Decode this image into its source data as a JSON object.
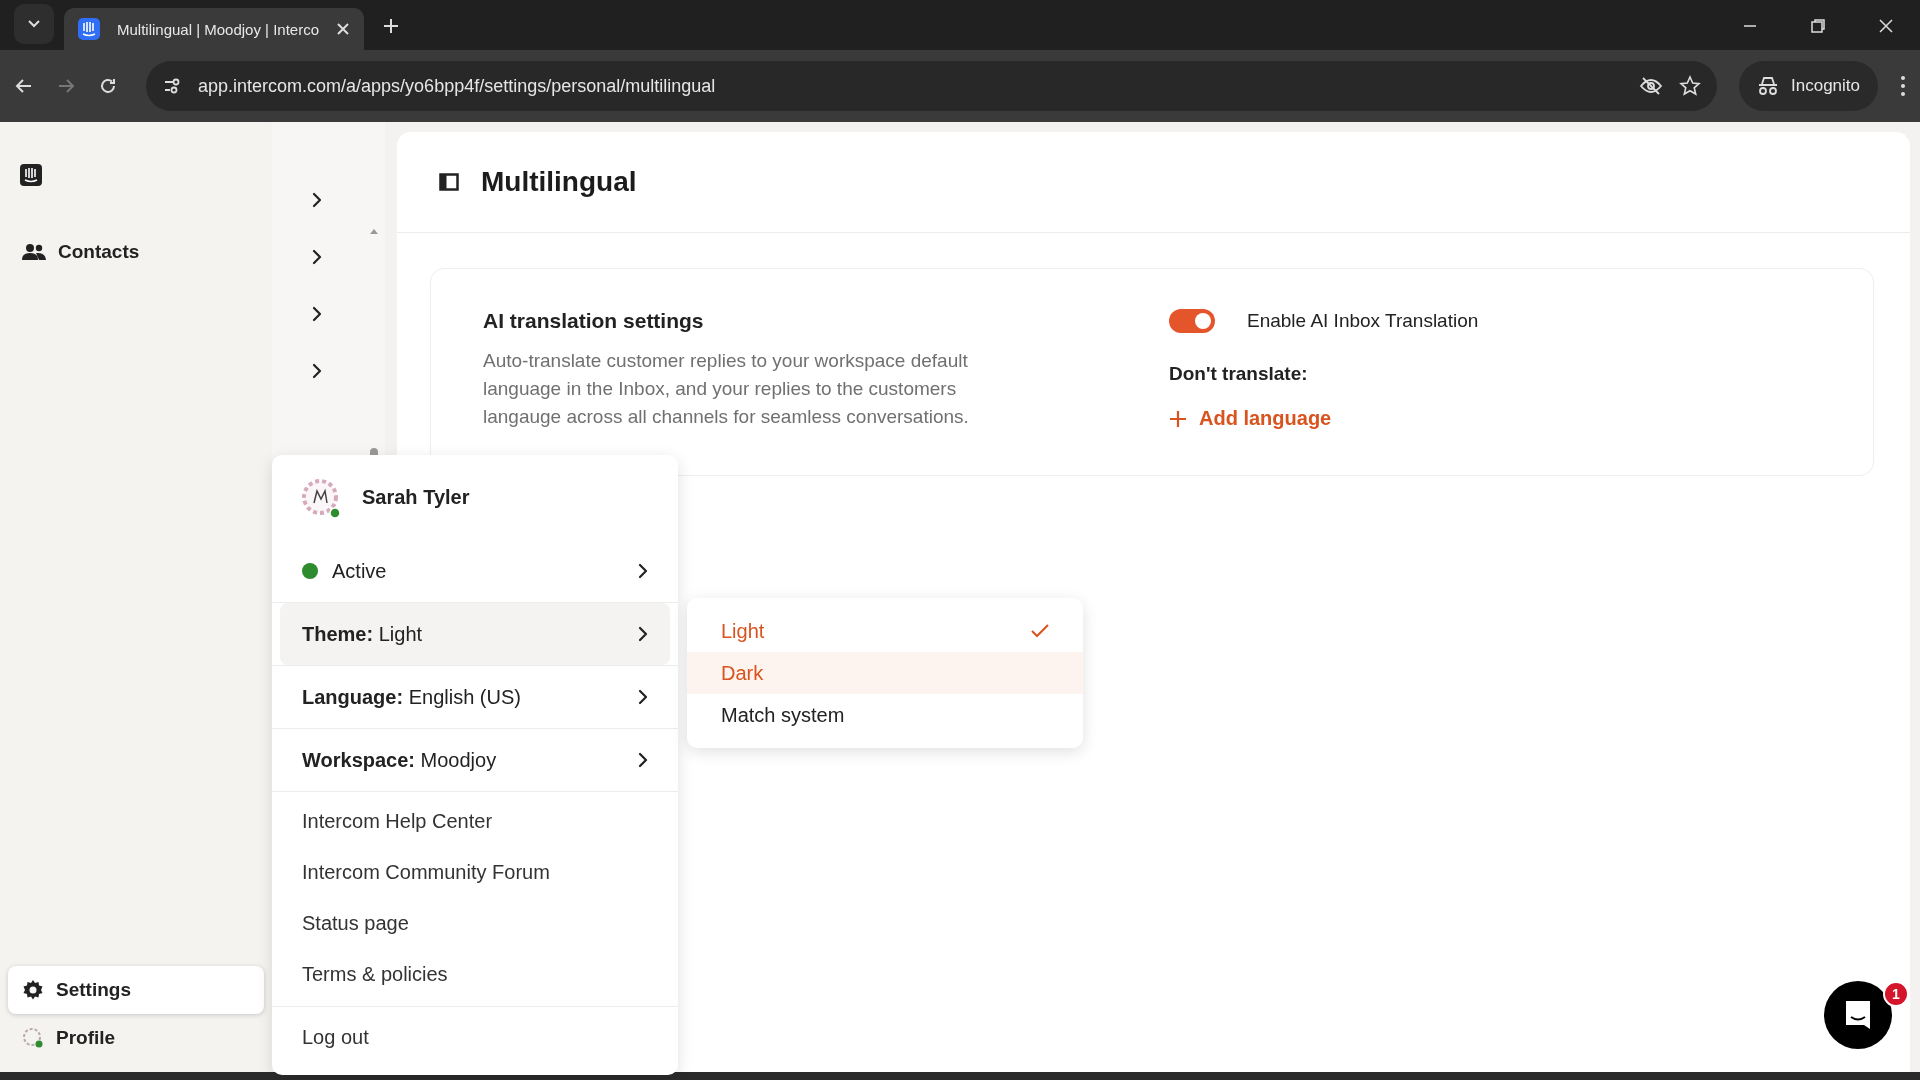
{
  "browser": {
    "tab_title": "Multilingual | Moodjoy | Interco",
    "url": "app.intercom.com/a/apps/yo6bpp4f/settings/personal/multilingual",
    "profile_label": "Incognito"
  },
  "sidebar": {
    "items": [
      {
        "label": "Contacts",
        "selected": false
      }
    ],
    "bottom_items": [
      {
        "kind": "settings",
        "label": "Settings",
        "selected": true
      },
      {
        "kind": "profile",
        "label": "Profile",
        "selected": false
      }
    ]
  },
  "page": {
    "title": "Multilingual"
  },
  "card": {
    "title": "AI translation settings",
    "description": "Auto-translate customer replies to your workspace default language in the Inbox, and your replies to the customers langauge across all channels for seamless conversations.",
    "toggle": {
      "label": "Enable AI Inbox Translation",
      "on": true
    },
    "dont_translate_label": "Don't translate:",
    "add_language": "Add language"
  },
  "user_menu": {
    "name": "Sarah Tyler",
    "status": {
      "label": "Active",
      "color": "#2e8b2e"
    },
    "settings": [
      {
        "key": "Theme:",
        "value": "Light",
        "expanded": true
      },
      {
        "key": "Language:",
        "value": "English (US)",
        "expanded": false
      },
      {
        "key": "Workspace:",
        "value": "Moodjoy",
        "expanded": false
      }
    ],
    "links": [
      "Intercom Help Center",
      "Intercom Community Forum",
      "Status page",
      "Terms & policies"
    ],
    "logout": "Log out"
  },
  "theme_options": [
    {
      "label": "Light",
      "selected": true,
      "hovered": false
    },
    {
      "label": "Dark",
      "selected": false,
      "hovered": true
    },
    {
      "label": "Match system",
      "selected": false,
      "hovered": false
    }
  ],
  "chat": {
    "badge": "1"
  }
}
